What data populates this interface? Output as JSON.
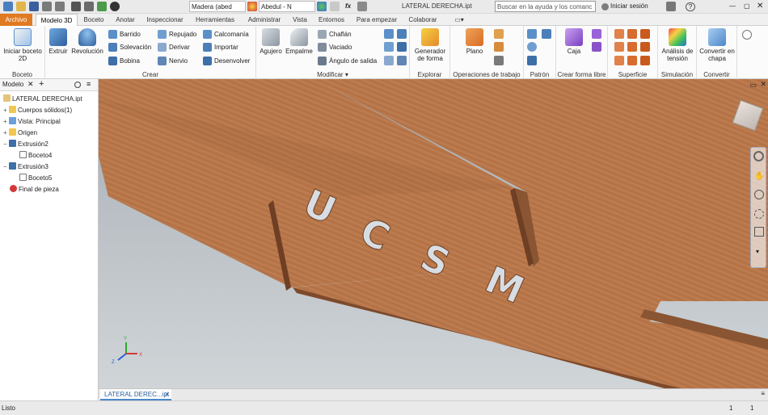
{
  "quick_access": {
    "material": "Madera (abed",
    "appearance": "Abedul - N",
    "fx": "fx",
    "doc_title": "LATERAL DERECHA.ipt",
    "search_placeholder": "Buscar en la ayuda y los comanc",
    "sign_in": "Iniciar sesión",
    "help": "?"
  },
  "tabs": [
    "Archivo",
    "Modelo 3D",
    "Boceto",
    "Anotar",
    "Inspeccionar",
    "Herramientas",
    "Administrar",
    "Vista",
    "Entornos",
    "Para empezar",
    "Colaborar"
  ],
  "active_tab": "Modelo 3D",
  "ribbon": {
    "boceto": {
      "label": "Boceto",
      "start_sketch": "Iniciar boceto 2D"
    },
    "crear": {
      "label": "Crear",
      "extrude": "Extruir",
      "revolve": "Revolución",
      "col1": [
        "Barrido",
        "Solevación",
        "Bobina"
      ],
      "col2": [
        "Repujado",
        "Derivar",
        "Nervio"
      ],
      "col3": [
        "Calcomanía",
        "Importar",
        "Desenvolver"
      ]
    },
    "modificar": {
      "label": "Modificar ▾",
      "hole": "Agujero",
      "fillet": "Empalme",
      "items": [
        "Chaflán",
        "Vaciado",
        "Ángulo de salida"
      ]
    },
    "explorar": {
      "label": "Explorar",
      "shape_gen": "Generador de forma"
    },
    "operaciones": {
      "label": "Operaciones de trabajo",
      "plane": "Plano"
    },
    "patron": {
      "label": "Patrón"
    },
    "crear_forma": {
      "label": "Crear forma libre",
      "box": "Caja"
    },
    "superficie": {
      "label": "Superficie"
    },
    "simulacion": {
      "label": "Simulación",
      "stress": "Análisis de tensión"
    },
    "convertir": {
      "label": "Convertir",
      "sheet": "Convertir en chapa"
    }
  },
  "browser": {
    "title": "Modelo",
    "nodes": [
      {
        "label": "LATERAL DERECHA.ipt",
        "icon": "part-icon"
      },
      {
        "label": "Cuerpos sólidos(1)",
        "icon": "folder-icon",
        "exp": "+"
      },
      {
        "label": "Vista: Principal",
        "icon": "view-icon",
        "exp": "+"
      },
      {
        "label": "Origen",
        "icon": "folder-icon",
        "exp": "+"
      },
      {
        "label": "Extrusión2",
        "icon": "extrude-icon",
        "exp": "−"
      },
      {
        "label": "Boceto4",
        "icon": "sketch-icon"
      },
      {
        "label": "Extrusión3",
        "icon": "extrude-icon",
        "exp": "−"
      },
      {
        "label": "Boceto5",
        "icon": "sketch-icon"
      },
      {
        "label": "Final de pieza",
        "icon": "end-of-part-icon"
      }
    ]
  },
  "viewport": {
    "engraved_letters": [
      "U",
      "C",
      "S",
      "M"
    ],
    "triad": {
      "x": "X",
      "y": "Y",
      "z": "Z"
    }
  },
  "document_tab": "LATERAL DEREC...ipt",
  "status": {
    "text": "Listo",
    "count1": "1",
    "count2": "1"
  },
  "colors": {
    "file_tab": "#e07a21",
    "wood": "#b8774a",
    "wood_dark": "#8a5533",
    "bg_top": "#9ea4aa"
  }
}
